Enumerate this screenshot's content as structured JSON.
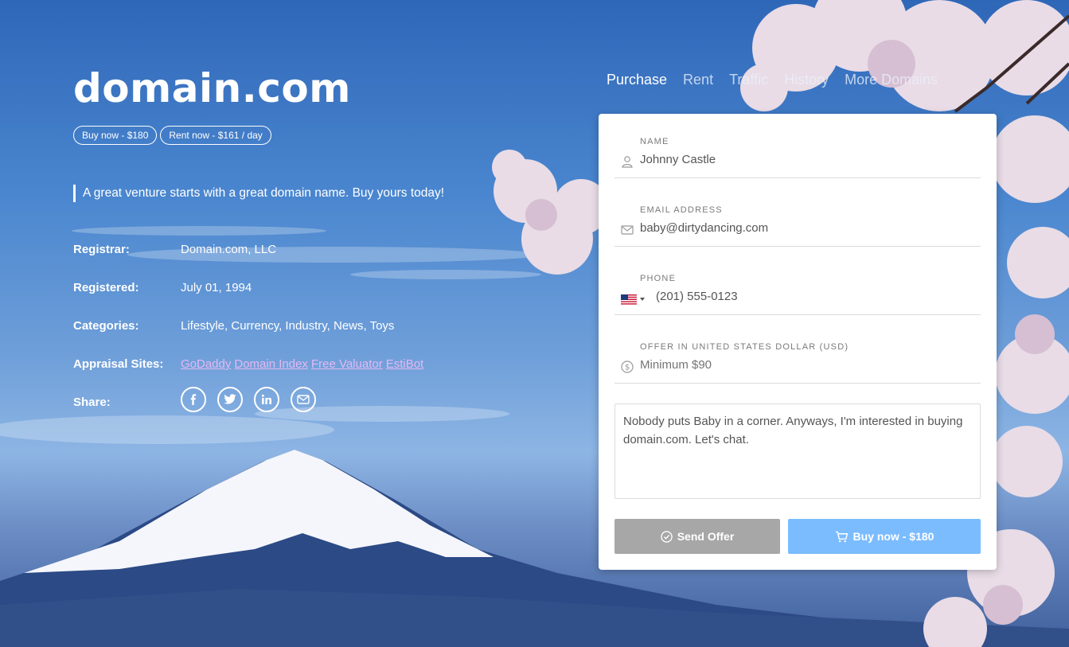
{
  "domain": {
    "title": "domain.com",
    "buy_pill": "Buy now - $180",
    "rent_pill": "Rent now - $161 / day",
    "tagline": "A great venture starts with a great domain name. Buy yours today!"
  },
  "info": {
    "registrar_label": "Registrar:",
    "registrar_value": "Domain.com, LLC",
    "registered_label": "Registered:",
    "registered_value": "July 01, 1994",
    "categories_label": "Categories:",
    "categories_value": "Lifestyle, Currency, Industry, News, Toys",
    "appraisal_label": "Appraisal Sites:",
    "appraisal_links": [
      "GoDaddy",
      "Domain Index",
      "Free Valuator",
      "EstiBot"
    ],
    "share_label": "Share:",
    "share_icons": [
      "facebook-icon",
      "twitter-icon",
      "linkedin-icon",
      "email-icon"
    ]
  },
  "nav": {
    "tabs": [
      "Purchase",
      "Rent",
      "Traffic",
      "History",
      "More Domains"
    ],
    "active": "Purchase"
  },
  "form": {
    "name_label": "NAME",
    "name_value": "Johnny Castle",
    "email_label": "EMAIL ADDRESS",
    "email_value": "baby@dirtydancing.com",
    "phone_label": "PHONE",
    "phone_value": "(201) 555-0123",
    "offer_label": "OFFER IN UNITED STATES DOLLAR (USD)",
    "offer_placeholder": "Minimum $90",
    "message": "Nobody puts Baby in a corner. Anyways, I'm interested in buying domain.com. Let's chat.",
    "send_button": "Send Offer",
    "buy_button": "Buy now - $180"
  },
  "colors": {
    "link": "#e4b8f3",
    "send_button": "#a7a7a7",
    "buy_button": "#7bbcff"
  }
}
